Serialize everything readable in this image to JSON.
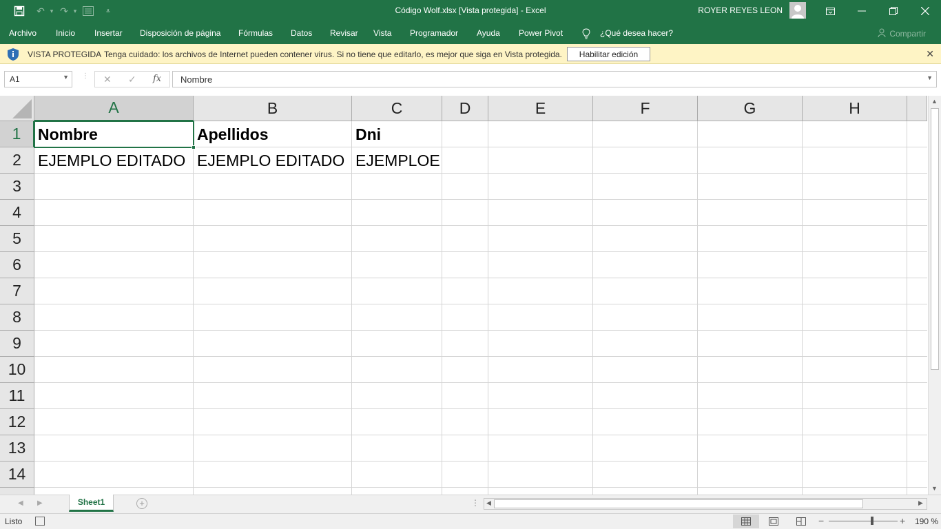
{
  "window": {
    "title": "Código Wolf.xlsx  [Vista protegida]  -  Excel",
    "user": "ROYER REYES LEON"
  },
  "ribbon": {
    "tabs": [
      "Archivo",
      "Inicio",
      "Insertar",
      "Disposición de página",
      "Fórmulas",
      "Datos",
      "Revisar",
      "Vista",
      "Programador",
      "Ayuda",
      "Power Pivot"
    ],
    "tell_me": "¿Qué desea hacer?",
    "share": "Compartir"
  },
  "protected_view": {
    "title": "VISTA PROTEGIDA",
    "message": "Tenga cuidado: los archivos de Internet pueden contener virus. Si no tiene que editarlo, es mejor que siga en Vista protegida.",
    "button": "Habilitar edición"
  },
  "formula_bar": {
    "name_box": "A1",
    "fx": "fx",
    "value": "Nombre"
  },
  "sheet": {
    "columns": [
      "A",
      "B",
      "C",
      "D",
      "E",
      "F",
      "G",
      "H"
    ],
    "rows": [
      "1",
      "2",
      "3",
      "4",
      "5",
      "6",
      "7",
      "8",
      "9",
      "10",
      "11",
      "12",
      "13",
      "14"
    ],
    "cells": {
      "A1": "Nombre",
      "B1": "Apellidos",
      "C1": "Dni",
      "A2": "EJEMPLO EDITADO",
      "B2": "EJEMPLO EDITADO",
      "C2": "EJEMPLOE"
    },
    "selected_cell": "A1"
  },
  "tabs": {
    "sheets": [
      "Sheet1"
    ]
  },
  "status": {
    "text": "Listo",
    "zoom": "190 %"
  },
  "colors": {
    "brand": "#217346",
    "protected_bar": "#fef4c5"
  }
}
